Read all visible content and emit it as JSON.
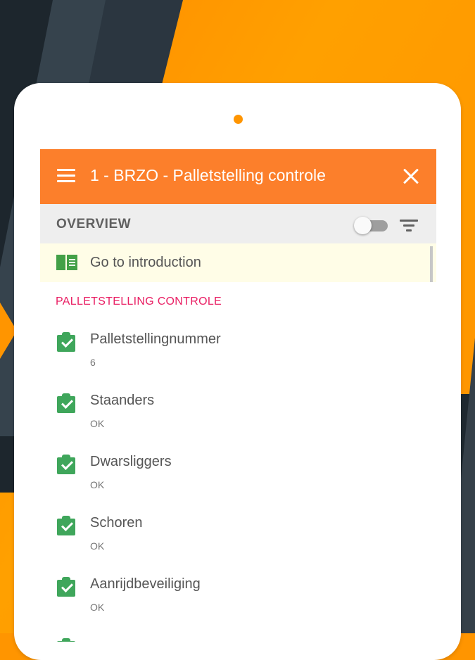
{
  "colors": {
    "appbar": "#fc7f2b",
    "accent_orange": "#ff9500",
    "check_green": "#3fa65b",
    "section_pink": "#e91e63",
    "intro_bg": "#fffde7"
  },
  "appbar": {
    "title": "1 - BRZO - Palletstelling controle",
    "menu_icon": "menu-icon",
    "close_icon": "close-icon"
  },
  "overview": {
    "label": "OVERVIEW",
    "toggle_on": false,
    "filter_icon": "filter-icon"
  },
  "intro": {
    "label": "Go to introduction",
    "icon": "book-icon"
  },
  "section": {
    "title": "PALLETSTELLING CONTROLE",
    "items": [
      {
        "label": "Palletstellingnummer",
        "value": "6",
        "icon": "checked-clipboard-icon"
      },
      {
        "label": "Staanders",
        "value": "OK",
        "icon": "checked-clipboard-icon"
      },
      {
        "label": "Dwarsliggers",
        "value": "OK",
        "icon": "checked-clipboard-icon"
      },
      {
        "label": "Schoren",
        "value": "OK",
        "icon": "checked-clipboard-icon"
      },
      {
        "label": "Aanrijdbeveiliging",
        "value": "OK",
        "icon": "checked-clipboard-icon"
      }
    ]
  }
}
